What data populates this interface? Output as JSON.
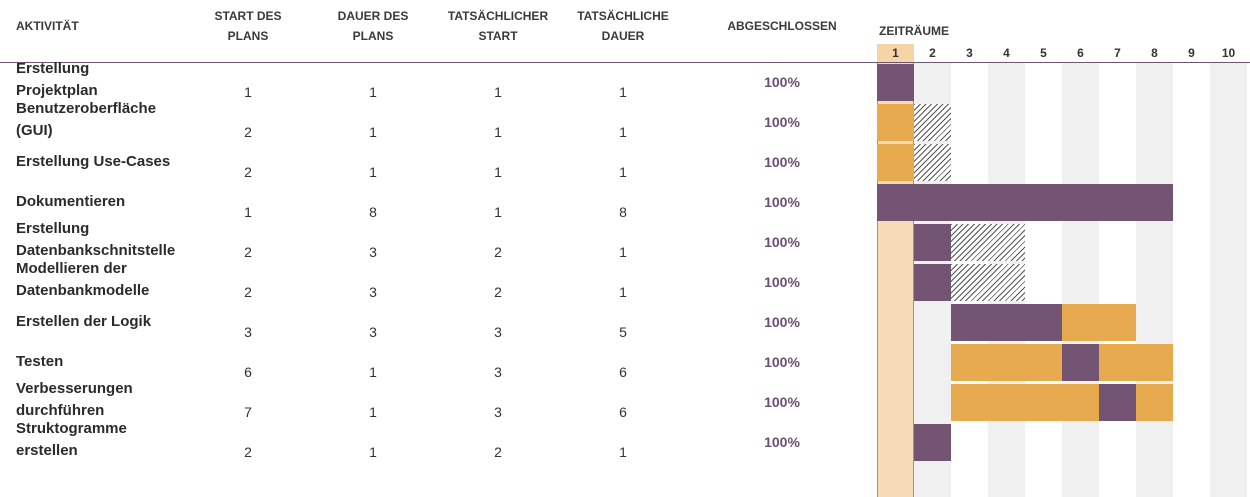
{
  "headers": {
    "activity": "AKTIVITÄT",
    "plan_start": [
      "START DES",
      "PLANS"
    ],
    "plan_duration": [
      "DAUER DES",
      "PLANS"
    ],
    "actual_start": [
      "TATSÄCHLICHER",
      "START"
    ],
    "actual_duration": [
      "TATSÄCHLICHE",
      "DAUER"
    ],
    "complete": "ABGESCHLOSSEN",
    "periods": "ZEITRÄUME"
  },
  "colors": {
    "plan": "#e8aa4e",
    "actual": "#735573",
    "current_period": "#f5dcb6",
    "percent_text": "#6b4f70"
  },
  "chart_data": {
    "type": "table",
    "periods": [
      "1",
      "2",
      "3",
      "4",
      "5",
      "6",
      "7",
      "8",
      "9",
      "10"
    ],
    "current_period": 1,
    "rows": [
      {
        "activity": [
          "Erstellung",
          "Projektplan"
        ],
        "plan_start": 1,
        "plan_duration": 1,
        "actual_start": 1,
        "actual_duration": 1,
        "percent_complete": "100%"
      },
      {
        "activity": [
          "Benutzeroberfläche",
          "(GUI)"
        ],
        "plan_start": 2,
        "plan_duration": 1,
        "actual_start": 1,
        "actual_duration": 1,
        "percent_complete": "100%"
      },
      {
        "activity": [
          "Erstellung Use-Cases"
        ],
        "plan_start": 2,
        "plan_duration": 1,
        "actual_start": 1,
        "actual_duration": 1,
        "percent_complete": "100%"
      },
      {
        "activity": [
          "Dokumentieren"
        ],
        "plan_start": 1,
        "plan_duration": 8,
        "actual_start": 1,
        "actual_duration": 8,
        "percent_complete": "100%"
      },
      {
        "activity": [
          "Erstellung",
          "Datenbankschnitstelle"
        ],
        "plan_start": 2,
        "plan_duration": 3,
        "actual_start": 2,
        "actual_duration": 1,
        "percent_complete": "100%"
      },
      {
        "activity": [
          "Modellieren der",
          "Datenbankmodelle"
        ],
        "plan_start": 2,
        "plan_duration": 3,
        "actual_start": 2,
        "actual_duration": 1,
        "percent_complete": "100%"
      },
      {
        "activity": [
          "Erstellen der Logik"
        ],
        "plan_start": 3,
        "plan_duration": 3,
        "actual_start": 3,
        "actual_duration": 5,
        "percent_complete": "100%"
      },
      {
        "activity": [
          "Testen"
        ],
        "plan_start": 6,
        "plan_duration": 1,
        "actual_start": 3,
        "actual_duration": 6,
        "percent_complete": "100%"
      },
      {
        "activity": [
          "Verbesserungen",
          "durchführen"
        ],
        "plan_start": 7,
        "plan_duration": 1,
        "actual_start": 3,
        "actual_duration": 6,
        "percent_complete": "100%"
      },
      {
        "activity": [
          "Struktogramme",
          "erstellen"
        ],
        "plan_start": 2,
        "plan_duration": 1,
        "actual_start": 2,
        "actual_duration": 1,
        "percent_complete": "100%"
      }
    ]
  }
}
